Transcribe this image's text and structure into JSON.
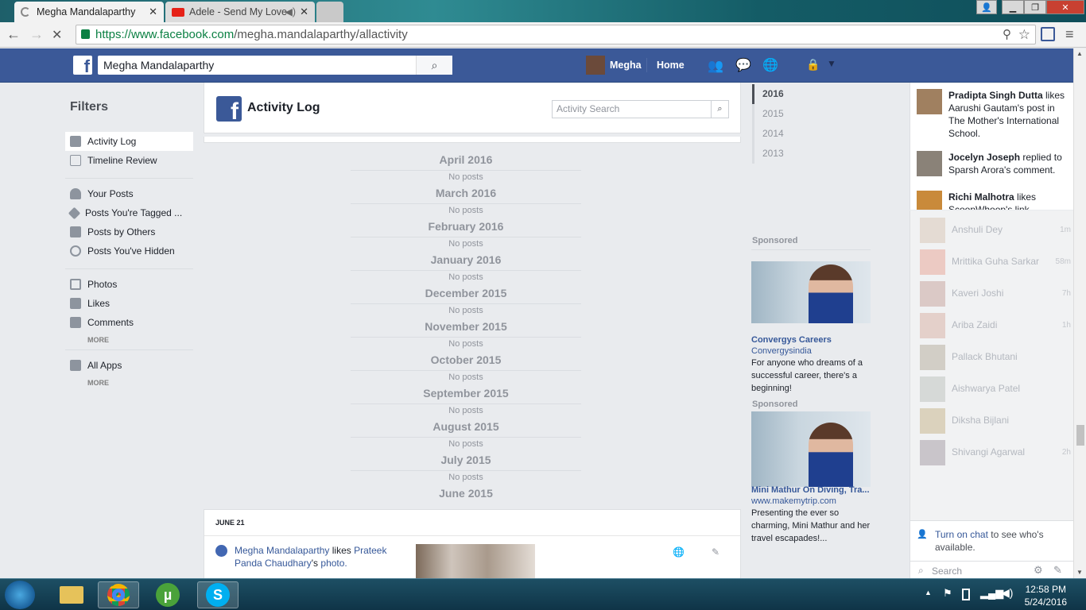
{
  "browser": {
    "tabs": [
      {
        "title": "Megha Mandalaparthy",
        "active": true
      },
      {
        "title": "Adele - Send My Love",
        "active": false
      }
    ],
    "url_prefix": "https://www.facebook.com",
    "url_path": "/megha.mandalaparthy/allactivity"
  },
  "fb": {
    "logo": "f",
    "search_value": "Megha Mandalaparthy",
    "profile_name": "Megha",
    "home": "Home"
  },
  "filters": {
    "title": "Filters",
    "items": [
      "Activity Log",
      "Timeline Review",
      "Your Posts",
      "Posts You're Tagged ...",
      "Posts by Others",
      "Posts You've Hidden",
      "Photos",
      "Likes",
      "Comments",
      "All Apps"
    ],
    "more": "MORE"
  },
  "activity_log": {
    "title": "Activity Log",
    "search_placeholder": "Activity Search",
    "no_posts": "No posts",
    "months": [
      "April 2016",
      "March 2016",
      "February 2016",
      "January 2016",
      "December 2015",
      "November 2015",
      "October 2015",
      "September 2015",
      "August 2015",
      "July 2015",
      "June 2015"
    ],
    "story": {
      "date": "JUNE 21",
      "actor": "Megha Mandalaparthy",
      "verb": "likes",
      "target": "Prateek Panda Chaudhary",
      "suffix": "'s",
      "object": "photo."
    }
  },
  "years": [
    "2016",
    "2015",
    "2014",
    "2013"
  ],
  "ads": [
    {
      "label": "Sponsored",
      "title": "Convergys Careers",
      "sub": "Convergysindia",
      "body": "For anyone who dreams of a successful career, there's a beginning!"
    },
    {
      "label": "Sponsored",
      "title": "Mini Mathur On Diving, Tra...",
      "sub": "www.makemytrip.com",
      "body": "Presenting the ever so charming, Mini Mathur and her travel escapades!..."
    }
  ],
  "ticker": [
    {
      "name": "Pradipta Singh Dutta",
      "text": " likes Aarushi Gautam's post in The Mother's International School."
    },
    {
      "name": "Jocelyn Joseph",
      "text": " replied to Sparsh Arora's comment."
    },
    {
      "name": "Richi Malhotra",
      "text": " likes ScoopWhoop's link."
    }
  ],
  "chat": [
    {
      "name": "Anshuli Dey",
      "time": "1m"
    },
    {
      "name": "Mrittika Guha Sarkar",
      "time": "58m"
    },
    {
      "name": "Kaveri Joshi",
      "time": "7h"
    },
    {
      "name": "Ariba Zaidi",
      "time": "1h"
    },
    {
      "name": "Pallack Bhutani",
      "time": ""
    },
    {
      "name": "Aishwarya Patel",
      "time": ""
    },
    {
      "name": "Diksha Bijlani",
      "time": ""
    },
    {
      "name": "Shivangi Agarwal",
      "time": "2h"
    }
  ],
  "chat_footer": {
    "link": "Turn on chat",
    "rest": " to see who's available.",
    "search": "Search"
  },
  "taskbar": {
    "time": "12:58 PM",
    "date": "5/24/2016"
  },
  "colors": {
    "fb_blue": "#3b5998",
    "link": "#365899"
  }
}
